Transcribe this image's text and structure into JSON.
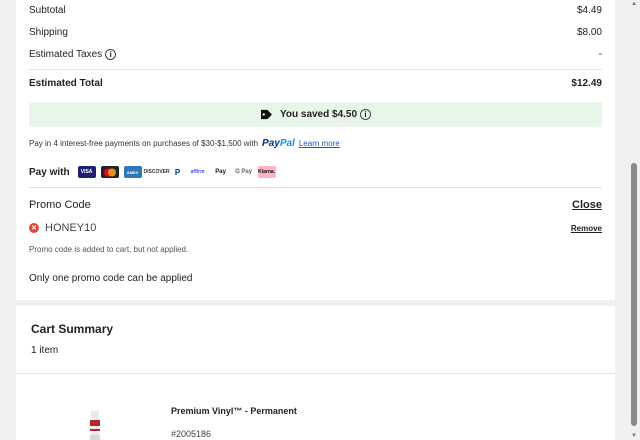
{
  "summary": {
    "subtotal_label": "Subtotal",
    "subtotal_value": "$4.49",
    "shipping_label": "Shipping",
    "shipping_value": "$8.00",
    "taxes_label": "Estimated Taxes",
    "taxes_value": "-",
    "total_label": "Estimated Total",
    "total_value": "$12.49"
  },
  "savings": {
    "text": "You saved $4.50"
  },
  "paypal": {
    "prefix": "Pay in 4 interest-free payments on purchases of $30-$1,500 with",
    "logo_part1": "Pay",
    "logo_part2": "Pal",
    "learn_more": "Learn more"
  },
  "pay_with": {
    "label": "Pay with",
    "methods": {
      "visa": "VISA",
      "amex": "AMEX",
      "discover": "DISCOVER",
      "paypal": "P",
      "affirm": "affirm",
      "applepay": "Pay",
      "gpay": "G Pay",
      "klarna": "Klarna."
    }
  },
  "promo": {
    "title": "Promo Code",
    "close_label": "Close",
    "code": "HONEY10",
    "remove_label": "Remove",
    "note": "Promo code is added to cart, but not applied.",
    "warning": "Only one promo code can be applied"
  },
  "cart_summary": {
    "title": "Cart Summary",
    "item_count": "1 item",
    "product_name": "Premium Vinyl™ - Permanent",
    "product_sku": "#2005186"
  },
  "icons": {
    "info": "info-icon",
    "tag": "tag-icon",
    "error": "error-x-icon"
  },
  "colors": {
    "savings_bg": "#e8f6ea",
    "error_red": "#e0443e",
    "link_blue": "#1a56c4",
    "paypal_dark": "#003087",
    "paypal_light": "#009cde"
  }
}
